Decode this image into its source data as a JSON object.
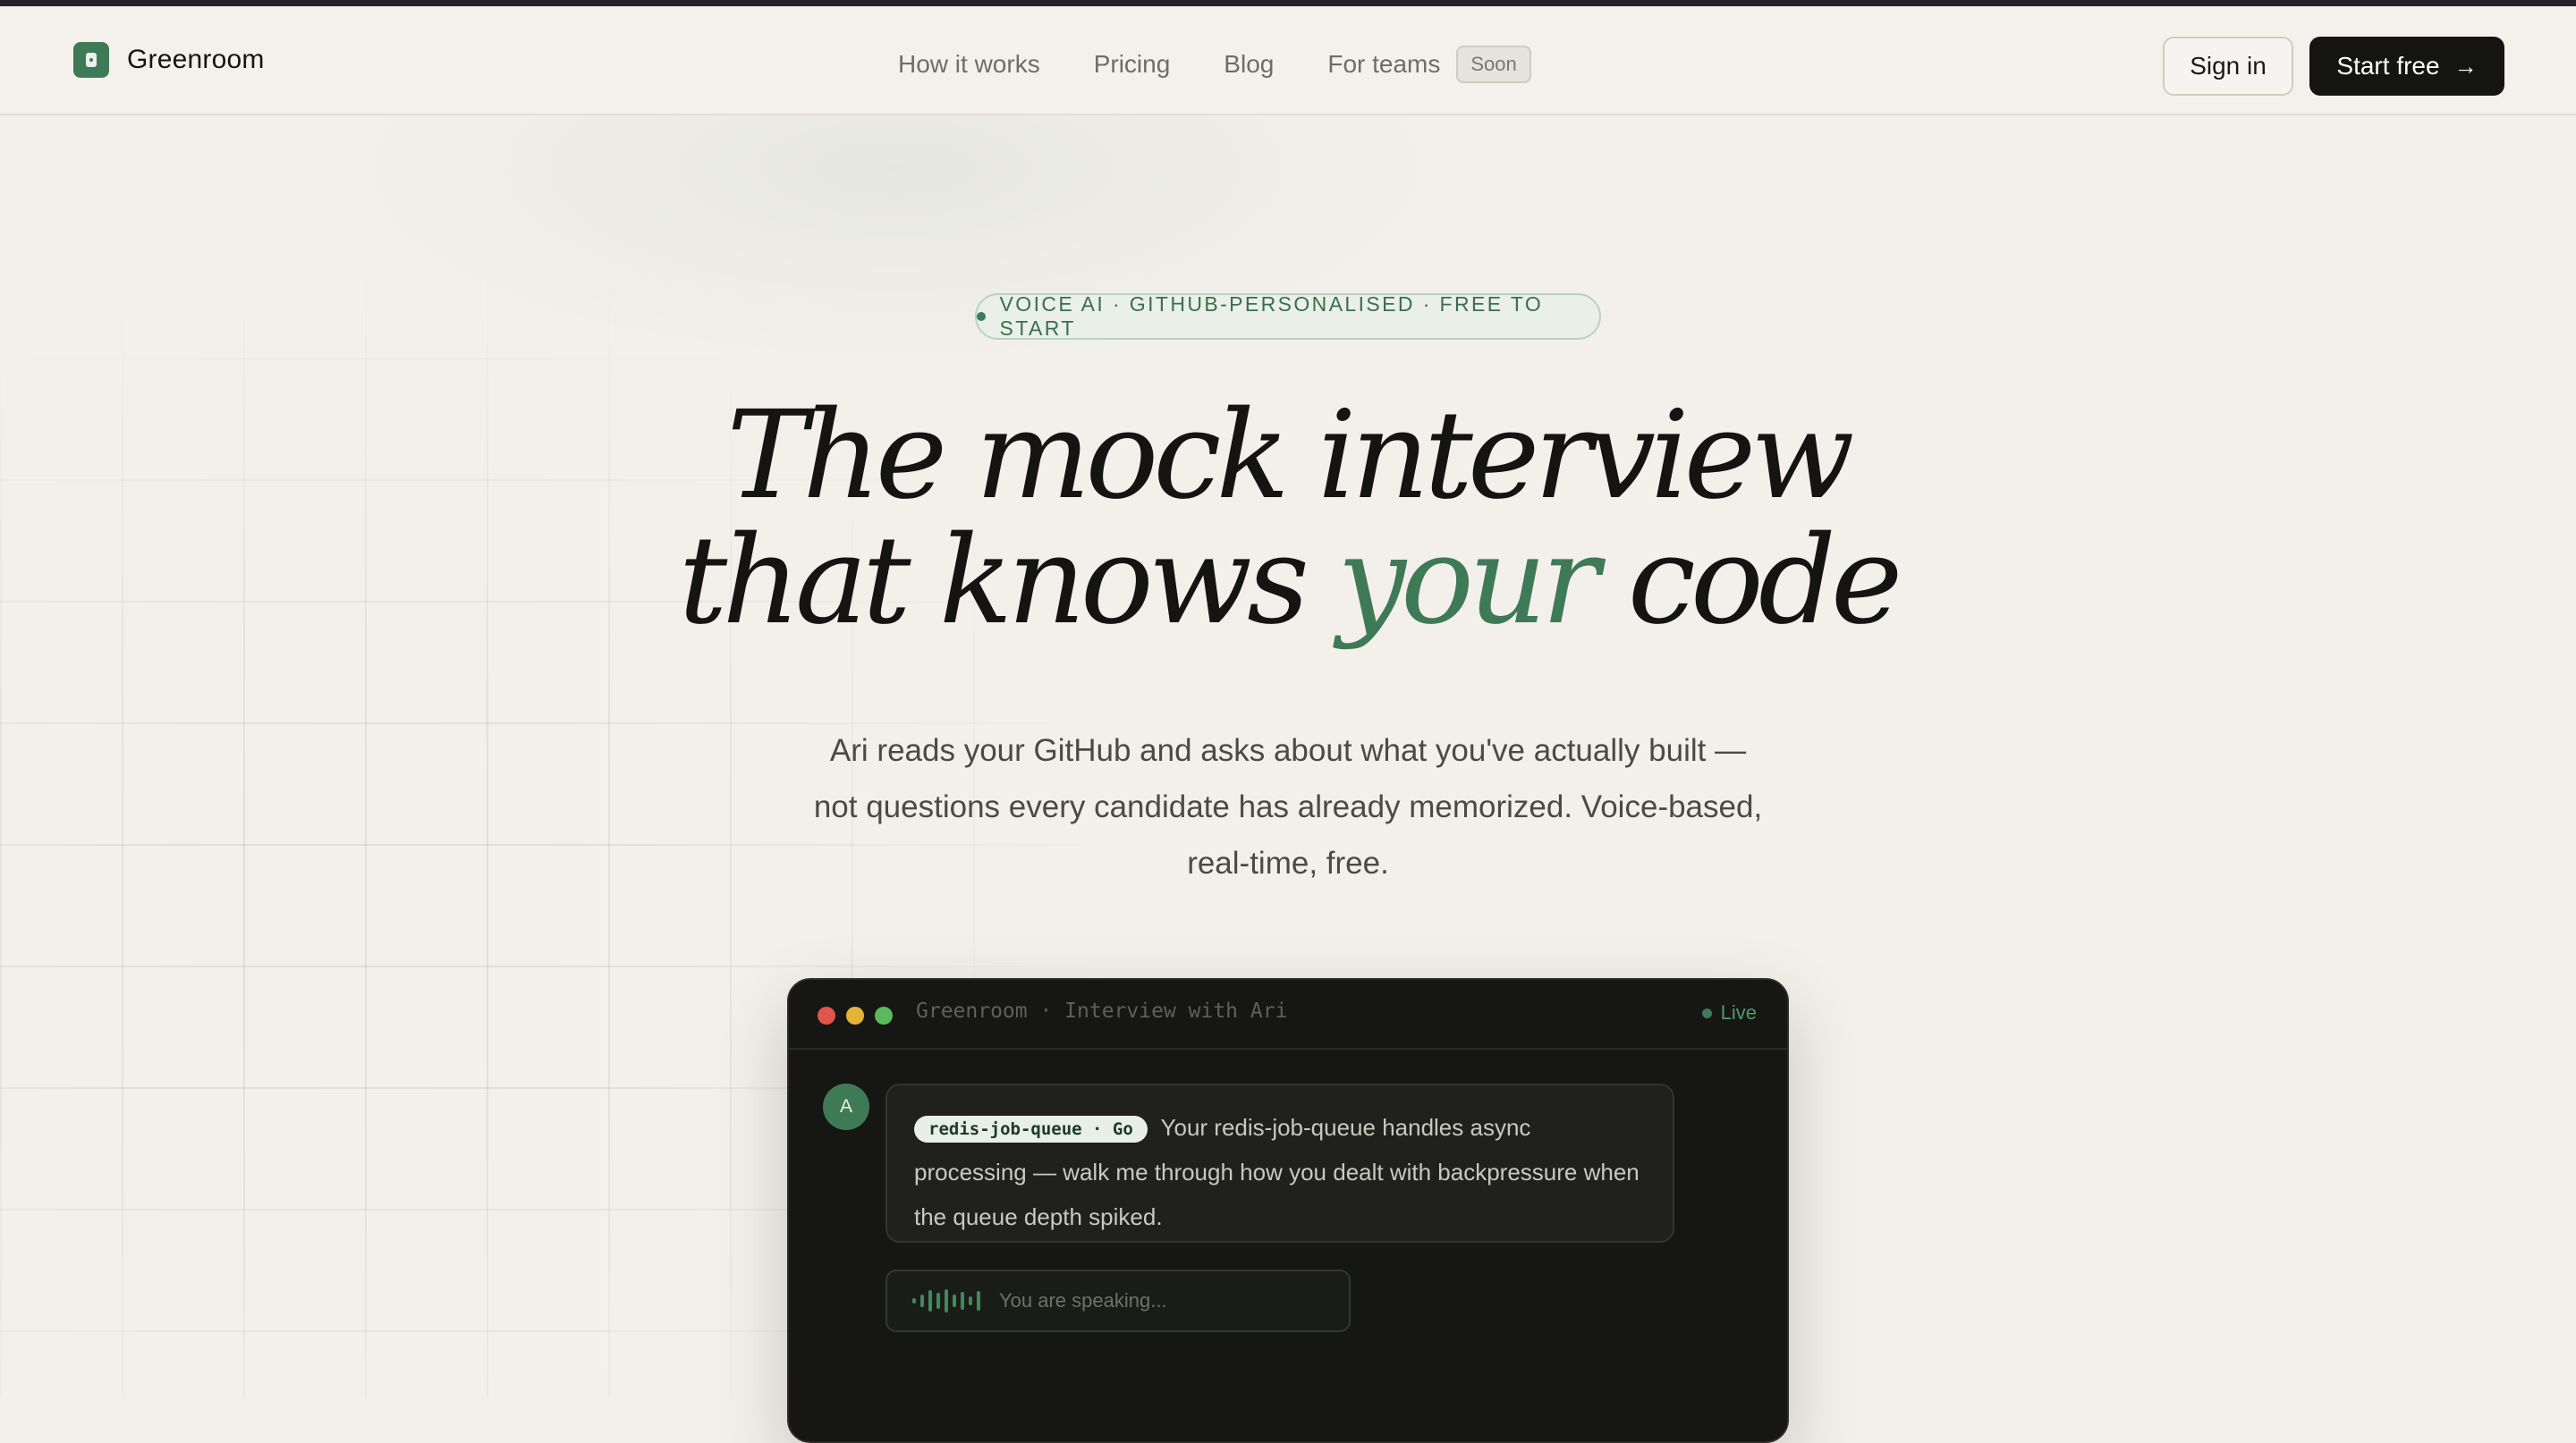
{
  "brand": {
    "name": "Greenroom",
    "accent": "#3f7a57"
  },
  "nav": {
    "links": [
      "How it works",
      "Pricing",
      "Blog",
      "For teams"
    ],
    "soon_badge": "Soon",
    "sign_in": "Sign in",
    "start_free": "Start free"
  },
  "hero": {
    "pill": "VOICE AI · GITHUB-PERSONALISED · FREE TO START",
    "title_line1": "The mock interview",
    "title_line2_a": "that knows",
    "title_line2_accent": "your",
    "title_line2_b": "code",
    "subtitle": "Ari reads your GitHub and asks about what you've actually built — not questions every candidate has already memorized. Voice-based, real-time, free."
  },
  "demo": {
    "window_title": "Greenroom · Interview with Ari",
    "status": "Live",
    "avatar_initial": "A",
    "tag": "redis-job-queue · Go",
    "message": "Your redis-job-queue handles async processing — walk me through how you dealt with backpressure when the queue depth spiked.",
    "speaking": "You are speaking..."
  },
  "icons": {
    "logo": "lock-icon",
    "start_arrow": "arrow-right-icon",
    "window_controls": [
      "close-dot-icon",
      "minimize-dot-icon",
      "maximize-dot-icon"
    ],
    "live": "live-dot-icon",
    "speaking": "waveform-icon"
  }
}
